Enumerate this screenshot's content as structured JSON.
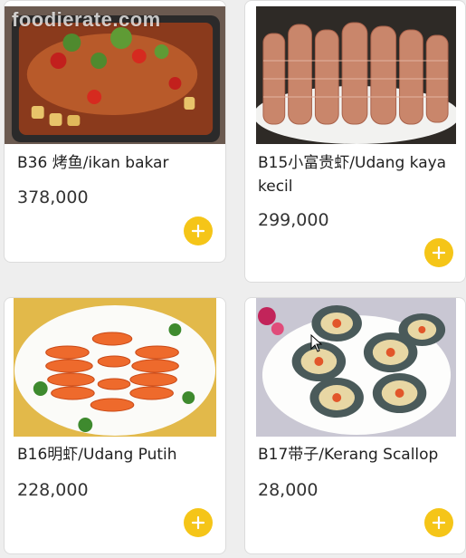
{
  "watermark": "foodierate.com",
  "items": [
    {
      "name": "B36 烤鱼/ikan bakar",
      "price": "378,000",
      "image": "grilled-fish-photo",
      "button_icon": "plus-icon"
    },
    {
      "name": "B15小富贵虾/Udang kaya kecil",
      "price": "299,000",
      "image": "mantis-shrimp-photo",
      "button_icon": "plus-icon"
    },
    {
      "name": "B16明虾/Udang Putih",
      "price": "228,000",
      "image": "boiled-prawns-photo",
      "button_icon": "plus-icon"
    },
    {
      "name": "B17带子/Kerang Scallop",
      "price": "28,000",
      "image": "steamed-scallops-photo",
      "button_icon": "plus-icon"
    }
  ],
  "colors": {
    "accent": "#f5c518",
    "card": "#ffffff",
    "background": "#eeeeee"
  }
}
